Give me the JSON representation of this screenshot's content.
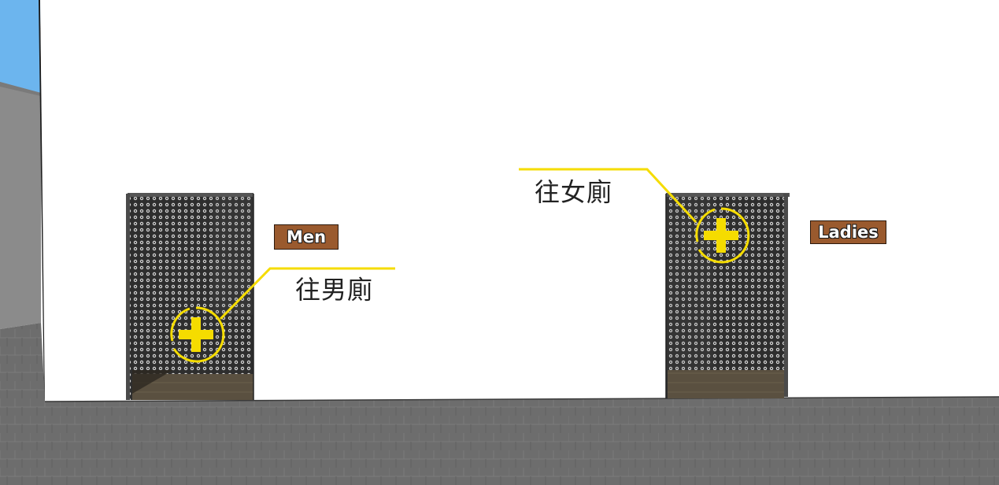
{
  "scene": {
    "wall_color": "#ffffff",
    "floor_color": "#6b6b6b",
    "accent_color": "#f5dc00"
  },
  "signs": {
    "men": "Men",
    "ladies": "Ladies"
  },
  "hotspots": {
    "men": {
      "label": "往男廁",
      "icon": "plus-circle-icon"
    },
    "ladies": {
      "label": "往女廁",
      "icon": "plus-circle-icon"
    }
  }
}
